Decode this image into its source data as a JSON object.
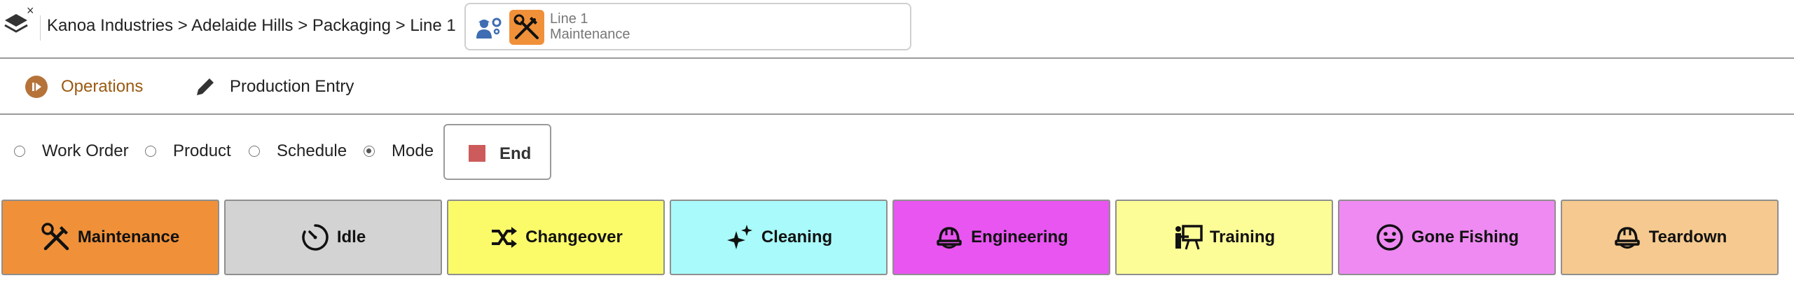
{
  "header": {
    "close_label": "×",
    "breadcrumb": "Kanoa Industries > Adelaide Hills > Packaging > Line 1",
    "asset_card": {
      "line": "Line 1",
      "status": "Maintenance",
      "accent_color": "#f0913a",
      "icons": [
        "worker-settings-icon",
        "wrench-screwdriver-icon"
      ]
    }
  },
  "tabs": [
    {
      "label": "Operations",
      "icon": "play-circle-icon",
      "active": true,
      "color": "#9a5a12"
    },
    {
      "label": "Production Entry",
      "icon": "pencil-icon",
      "active": false
    }
  ],
  "selector": {
    "options": [
      {
        "label": "Work Order",
        "selected": false
      },
      {
        "label": "Product",
        "selected": false
      },
      {
        "label": "Schedule",
        "selected": false
      },
      {
        "label": "Mode",
        "selected": true
      }
    ],
    "end_button": {
      "label": "End",
      "icon": "stop-square-icon",
      "color": "#cd5b5b"
    }
  },
  "modes": [
    {
      "label": "Maintenance",
      "icon": "wrench-screwdriver-icon",
      "color": "#f0913a"
    },
    {
      "label": "Idle",
      "icon": "timer-icon",
      "color": "#d3d3d3"
    },
    {
      "label": "Changeover",
      "icon": "shuffle-icon",
      "color": "#fbfb6a"
    },
    {
      "label": "Cleaning",
      "icon": "sparkles-icon",
      "color": "#a9fafa"
    },
    {
      "label": "Engineering",
      "icon": "hard-hat-icon",
      "color": "#e855f0"
    },
    {
      "label": "Training",
      "icon": "presenter-board-icon",
      "color": "#fdfd98"
    },
    {
      "label": "Gone Fishing",
      "icon": "smiley-icon",
      "color": "#ee8af2"
    },
    {
      "label": "Teardown",
      "icon": "hard-hat-icon",
      "color": "#f5c98f"
    }
  ]
}
